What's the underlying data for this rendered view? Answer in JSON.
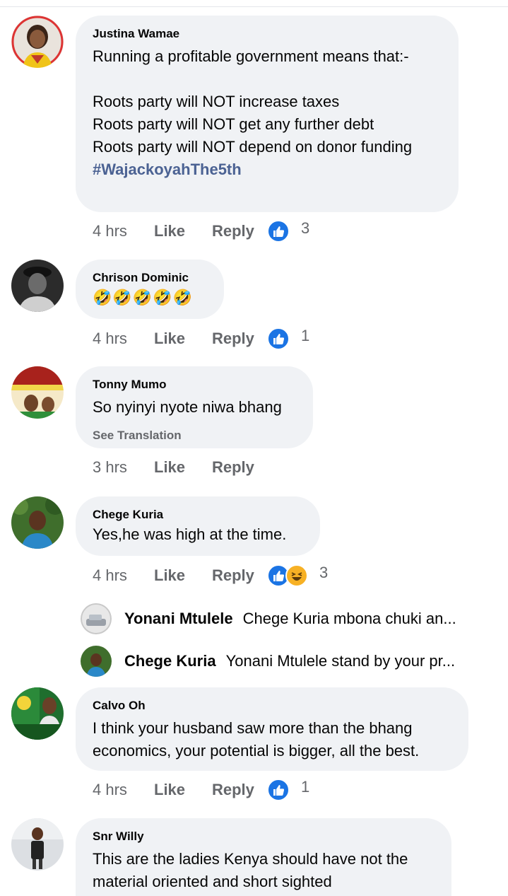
{
  "colors": {
    "bubble": "#f0f2f5",
    "secondary_text": "#65676b",
    "hashtag": "#4b6293",
    "like_blue": "#1b74e4",
    "haha_yellow": "#f7b125"
  },
  "comments": [
    {
      "author": "Justina Wamae",
      "text": "Running a profitable government means that:-\n\nRoots party will NOT increase taxes\nRoots party will NOT get any further debt\nRoots party will NOT depend on donor funding\n",
      "hashtag": "#WajackoyahThe5th",
      "time": "4 hrs",
      "like_label": "Like",
      "reply_label": "Reply",
      "reactions": [
        "like-icon"
      ],
      "reaction_count": "3"
    },
    {
      "author": "Chrison Dominic",
      "text": "🤣🤣🤣🤣🤣",
      "time": "4 hrs",
      "like_label": "Like",
      "reply_label": "Reply",
      "reactions": [
        "like-icon"
      ],
      "reaction_count": "1"
    },
    {
      "author": "Tonny Mumo",
      "text": "So nyinyi nyote niwa bhang",
      "see_translation": "See Translation",
      "time": "3 hrs",
      "like_label": "Like",
      "reply_label": "Reply"
    },
    {
      "author": "Chege Kuria",
      "text": "Yes,he was high at the time.",
      "time": "4 hrs",
      "like_label": "Like",
      "reply_label": "Reply",
      "reactions": [
        "like-icon",
        "haha-icon"
      ],
      "reaction_count": "3",
      "replies": [
        {
          "author": "Yonani Mtulele",
          "text": "Chege Kuria mbona chuki an..."
        },
        {
          "author": "Chege Kuria",
          "text": "Yonani Mtulele stand by your pr..."
        }
      ]
    },
    {
      "author": "Calvo Oh",
      "text": "I think your husband saw more than the bhang\neconomics, your potential is bigger, all the best.",
      "time": "4 hrs",
      "like_label": "Like",
      "reply_label": "Reply",
      "reactions": [
        "like-icon"
      ],
      "reaction_count": "1"
    },
    {
      "author": "Snr Willy",
      "text": "This are the ladies Kenya should have not the\nmaterial oriented and short sighted"
    }
  ]
}
